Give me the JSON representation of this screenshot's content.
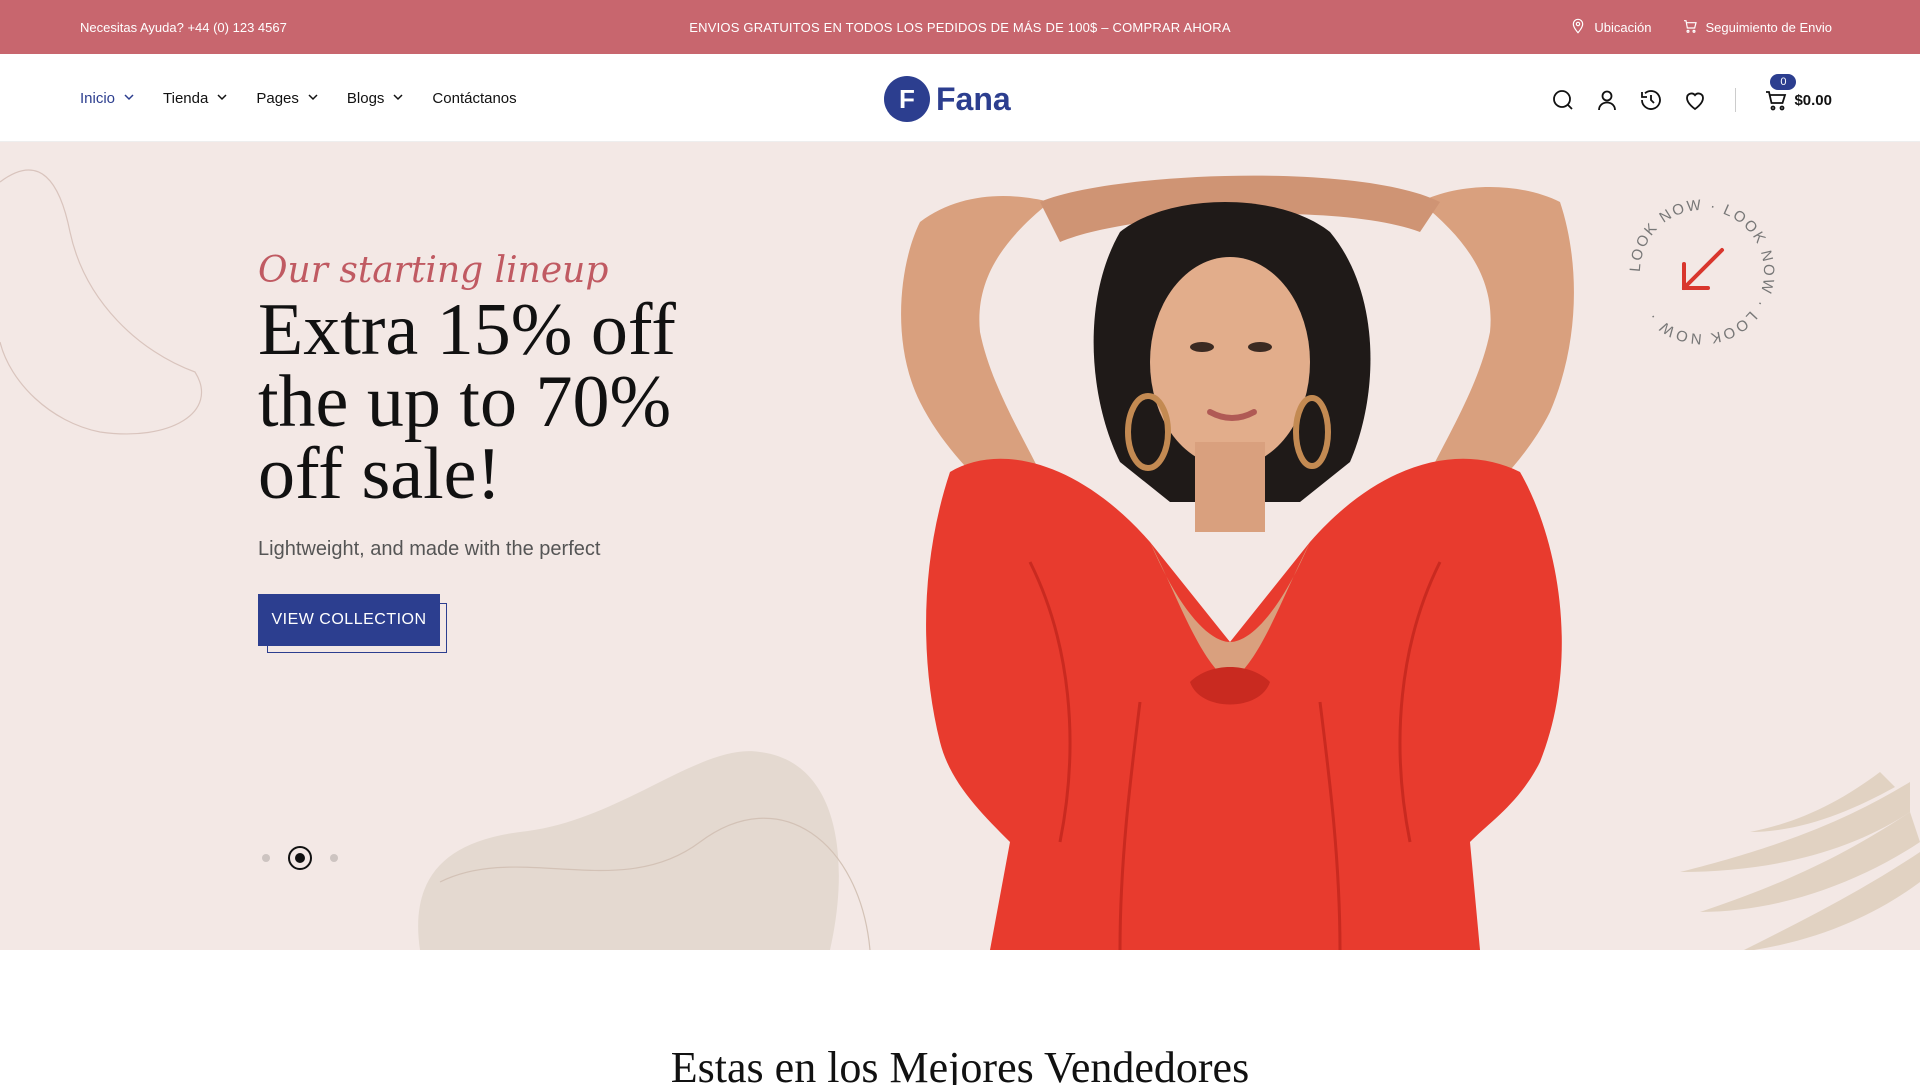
{
  "topbar": {
    "help_text": "Necesitas Ayuda? +44 (0) 123 4567",
    "promo_text": "ENVIOS GRATUITOS EN TODOS LOS PEDIDOS DE MÁS DE 100$ – COMPRAR AHORA",
    "location_label": "Ubicación",
    "tracking_label": "Seguimiento de Envio",
    "background_color": "#c8666e"
  },
  "header": {
    "nav": [
      {
        "label": "Inicio",
        "active": true
      },
      {
        "label": "Tienda"
      },
      {
        "label": "Pages"
      },
      {
        "label": "Blogs"
      },
      {
        "label": "Contáctanos"
      }
    ],
    "logo_text": "Fana",
    "logo_letter": "F",
    "cart_count": "0",
    "cart_total": "$0.00",
    "icons": [
      "search-icon",
      "user-icon",
      "history-icon",
      "heart-icon",
      "cart-icon"
    ],
    "accent_color": "#2c3e8f"
  },
  "hero": {
    "tagline": "Our starting lineup",
    "headline": "Extra 15% off the up to 70% off sale!",
    "subtitle": "Lightweight, and made with the perfect",
    "cta_label": "VIEW COLLECTION",
    "badge_text": "LOOK NOW · LOOK NOW · LOOK NOW ·",
    "slides": 3,
    "active_slide": 2,
    "background_color": "#f3e8e5"
  },
  "section": {
    "title": "Estas en los Mejores Vendedores"
  }
}
